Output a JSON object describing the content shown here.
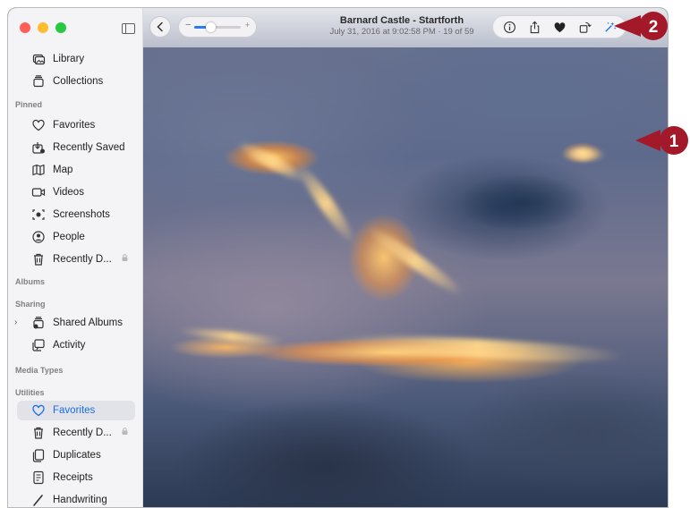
{
  "header": {
    "title": "Barnard Castle - Startforth",
    "subtitle": "July 31, 2016 at 9:02:58 PM  ·  19 of 59"
  },
  "zoom": {
    "level": 0.35,
    "minus": "−",
    "plus": "+"
  },
  "sidebar": {
    "items": [
      {
        "label": "Library",
        "icon": "photo-library-icon"
      },
      {
        "label": "Collections",
        "icon": "collections-icon"
      }
    ],
    "sections": {
      "pinned": "Pinned",
      "albums": "Albums",
      "sharing": "Sharing",
      "media_types": "Media Types",
      "utilities": "Utilities"
    },
    "pinned": [
      {
        "label": "Favorites",
        "icon": "heart-icon"
      },
      {
        "label": "Recently Saved",
        "icon": "recently-saved-icon"
      },
      {
        "label": "Map",
        "icon": "map-icon"
      },
      {
        "label": "Videos",
        "icon": "video-icon"
      },
      {
        "label": "Screenshots",
        "icon": "screenshot-icon"
      },
      {
        "label": "People",
        "icon": "person-icon"
      },
      {
        "label": "Recently D...",
        "icon": "trash-icon",
        "locked": true
      }
    ],
    "sharing": [
      {
        "label": "Shared Albums",
        "icon": "shared-albums-icon"
      },
      {
        "label": "Activity",
        "icon": "activity-icon"
      }
    ],
    "utilities": [
      {
        "label": "Favorites",
        "icon": "heart-icon",
        "active": true
      },
      {
        "label": "Recently D...",
        "icon": "trash-icon",
        "locked": true
      },
      {
        "label": "Duplicates",
        "icon": "duplicates-icon"
      },
      {
        "label": "Receipts",
        "icon": "receipt-icon"
      },
      {
        "label": "Handwriting",
        "icon": "pencil-icon"
      }
    ]
  },
  "toolbar": {
    "actions": [
      "info-icon",
      "share-icon",
      "heart-icon",
      "rotate-icon",
      "enhance-icon"
    ]
  },
  "callouts": {
    "one": "1",
    "two": "2"
  },
  "colors": {
    "accent": "#1a6ce8",
    "callout": "#a3192a",
    "traffic_red": "#ff5f57",
    "traffic_yellow": "#febc2e",
    "traffic_green": "#28c840"
  }
}
